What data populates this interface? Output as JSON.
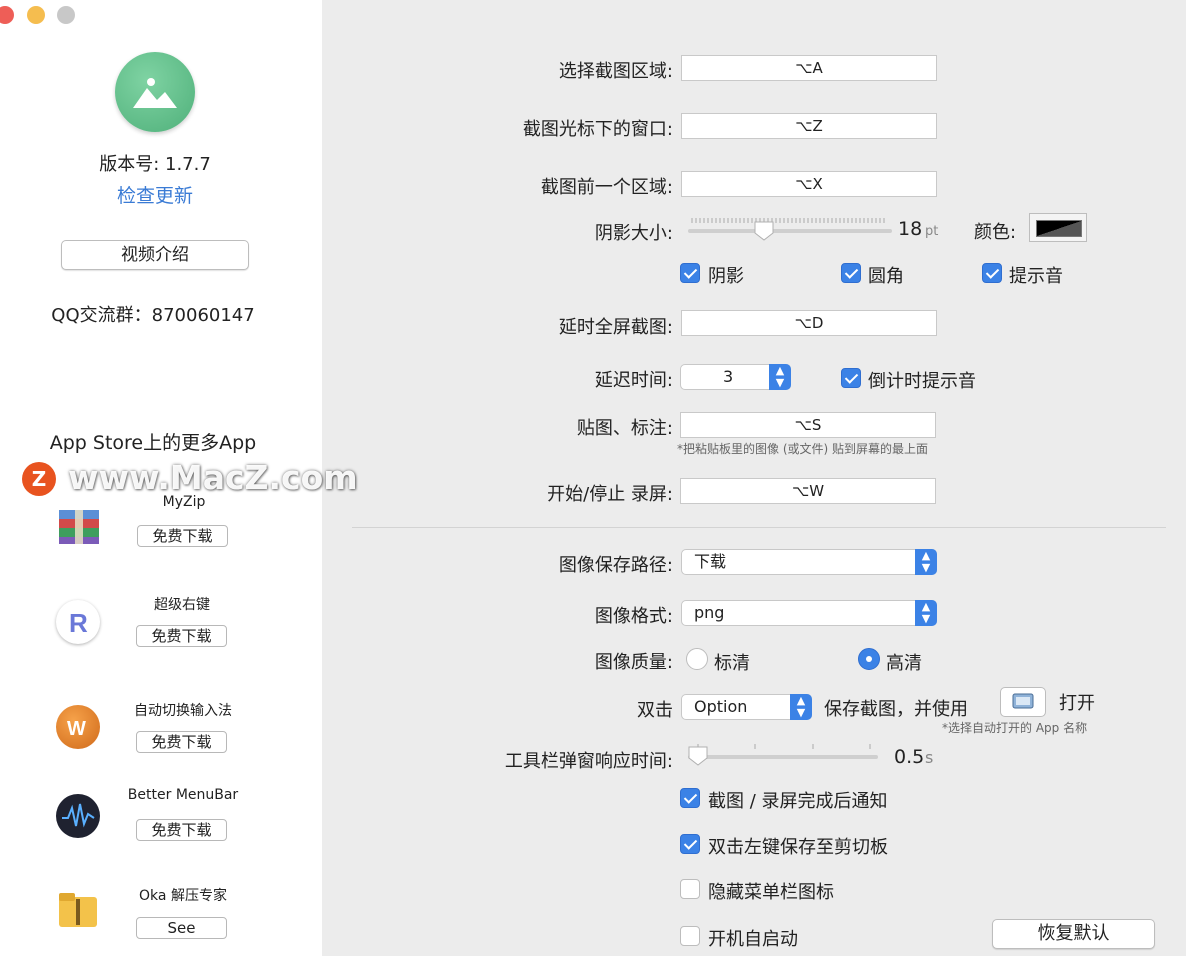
{
  "sidebar": {
    "version_label": "版本号: 1.7.7",
    "check_update": "检查更新",
    "video_intro": "视频介绍",
    "qq_group": "QQ交流群：870060147",
    "more_apps_title": "App Store上的更多App",
    "watermark": "www.MacZ.com",
    "apps": [
      {
        "name": "MyZip",
        "button": "免费下载"
      },
      {
        "name": "超级右键",
        "button": "免费下载"
      },
      {
        "name": "自动切换输入法",
        "button": "免费下载"
      },
      {
        "name": "Better MenuBar",
        "button": "免费下载"
      },
      {
        "name": "Oka 解压专家",
        "button": "See"
      }
    ]
  },
  "shortcuts": {
    "select_area": {
      "label": "选择截图区域:",
      "value": "⌥A"
    },
    "window_under_cursor": {
      "label": "截图光标下的窗口:",
      "value": "⌥Z"
    },
    "previous_area": {
      "label": "截图前一个区域:",
      "value": "⌥X"
    },
    "delay_fullscreen": {
      "label": "延时全屏截图:",
      "value": "⌥D"
    },
    "pin_annotate": {
      "label": "贴图、标注:",
      "value": "⌥S",
      "note": "*把粘贴板里的图像 (或文件) 贴到屏幕的最上面"
    },
    "record": {
      "label": "开始/停止 录屏:",
      "value": "⌥W"
    }
  },
  "shadow": {
    "label": "阴影大小:",
    "value": "18",
    "unit": "pt",
    "value_fraction": 0.36,
    "color_label": "颜色:"
  },
  "options_row": {
    "shadow": {
      "label": "阴影",
      "checked": true
    },
    "rounded": {
      "label": "圆角",
      "checked": true
    },
    "sound": {
      "label": "提示音",
      "checked": true
    }
  },
  "delay": {
    "label": "延迟时间:",
    "value": "3",
    "countdown_label": "倒计时提示音",
    "countdown_checked": true
  },
  "save": {
    "path_label": "图像保存路径:",
    "path_value": "下载",
    "format_label": "图像格式:",
    "format_value": "png",
    "quality_label": "图像质量:",
    "quality_sd": "标清",
    "quality_hd": "高清",
    "quality_selected": "高清"
  },
  "double_click": {
    "label": "双击",
    "modifier": "Option",
    "text": "保存截图，并使用",
    "open": "打开",
    "note": "*选择自动打开的 App 名称"
  },
  "toolbar_delay": {
    "label": "工具栏弹窗响应时间:",
    "value": "0.5",
    "unit": "s",
    "value_fraction": 0.0
  },
  "checks": {
    "notify": {
      "label": "截图 / 录屏完成后通知",
      "checked": true
    },
    "double_left": {
      "label": "双击左键保存至剪切板",
      "checked": true
    },
    "hide_menu_icon": {
      "label": "隐藏菜单栏图标",
      "checked": false
    },
    "launch_at_login": {
      "label": "开机自启动",
      "checked": false
    }
  },
  "restore_defaults": "恢复默认",
  "colors": {
    "accent": "#3b82e6",
    "link": "#3a7bd5",
    "close": "#ee5e57",
    "minimize": "#f5bd4f",
    "zoom": "#c8c8c8"
  }
}
